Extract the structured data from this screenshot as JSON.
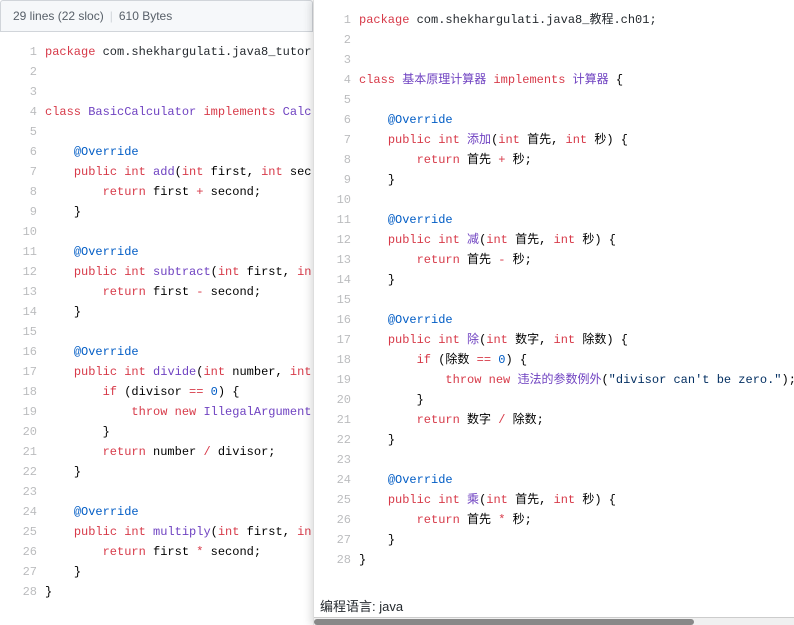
{
  "header": {
    "lines": "29 lines (22 sloc)",
    "size": "610 Bytes"
  },
  "left": {
    "lines": [
      {
        "n": "1",
        "indent": 0,
        "tokens": [
          {
            "t": "package ",
            "c": "kw"
          },
          {
            "t": "com.shekhargulati.java8_tutor",
            "c": "pkg"
          }
        ]
      },
      {
        "n": "2",
        "indent": 0,
        "tokens": []
      },
      {
        "n": "3",
        "indent": 0,
        "tokens": []
      },
      {
        "n": "4",
        "indent": 0,
        "tokens": [
          {
            "t": "class ",
            "c": "kw"
          },
          {
            "t": "BasicCalculator",
            "c": "cls"
          },
          {
            "t": " implements ",
            "c": "kw"
          },
          {
            "t": "Calc",
            "c": "cls"
          }
        ]
      },
      {
        "n": "5",
        "indent": 0,
        "tokens": []
      },
      {
        "n": "6",
        "indent": 1,
        "tokens": [
          {
            "t": "@Override",
            "c": "ann"
          }
        ]
      },
      {
        "n": "7",
        "indent": 1,
        "tokens": [
          {
            "t": "public ",
            "c": "kw"
          },
          {
            "t": "int ",
            "c": "kw"
          },
          {
            "t": "add",
            "c": "fn"
          },
          {
            "t": "(",
            "c": ""
          },
          {
            "t": "int ",
            "c": "kw"
          },
          {
            "t": "first",
            "c": ""
          },
          {
            "t": ", ",
            "c": ""
          },
          {
            "t": "int ",
            "c": "kw"
          },
          {
            "t": "sec",
            "c": ""
          }
        ]
      },
      {
        "n": "8",
        "indent": 2,
        "tokens": [
          {
            "t": "return ",
            "c": "kw"
          },
          {
            "t": "first ",
            "c": ""
          },
          {
            "t": "+",
            "c": "kw"
          },
          {
            "t": " second;",
            "c": ""
          }
        ]
      },
      {
        "n": "9",
        "indent": 1,
        "tokens": [
          {
            "t": "}",
            "c": ""
          }
        ]
      },
      {
        "n": "10",
        "indent": 0,
        "tokens": []
      },
      {
        "n": "11",
        "indent": 1,
        "tokens": [
          {
            "t": "@Override",
            "c": "ann"
          }
        ]
      },
      {
        "n": "12",
        "indent": 1,
        "tokens": [
          {
            "t": "public ",
            "c": "kw"
          },
          {
            "t": "int ",
            "c": "kw"
          },
          {
            "t": "subtract",
            "c": "fn"
          },
          {
            "t": "(",
            "c": ""
          },
          {
            "t": "int ",
            "c": "kw"
          },
          {
            "t": "first",
            "c": ""
          },
          {
            "t": ", ",
            "c": ""
          },
          {
            "t": "in",
            "c": "kw"
          }
        ]
      },
      {
        "n": "13",
        "indent": 2,
        "tokens": [
          {
            "t": "return ",
            "c": "kw"
          },
          {
            "t": "first ",
            "c": ""
          },
          {
            "t": "-",
            "c": "kw"
          },
          {
            "t": " second;",
            "c": ""
          }
        ]
      },
      {
        "n": "14",
        "indent": 1,
        "tokens": [
          {
            "t": "}",
            "c": ""
          }
        ]
      },
      {
        "n": "15",
        "indent": 0,
        "tokens": []
      },
      {
        "n": "16",
        "indent": 1,
        "tokens": [
          {
            "t": "@Override",
            "c": "ann"
          }
        ]
      },
      {
        "n": "17",
        "indent": 1,
        "tokens": [
          {
            "t": "public ",
            "c": "kw"
          },
          {
            "t": "int ",
            "c": "kw"
          },
          {
            "t": "divide",
            "c": "fn"
          },
          {
            "t": "(",
            "c": ""
          },
          {
            "t": "int ",
            "c": "kw"
          },
          {
            "t": "number",
            "c": ""
          },
          {
            "t": ", ",
            "c": ""
          },
          {
            "t": "int",
            "c": "kw"
          }
        ]
      },
      {
        "n": "18",
        "indent": 2,
        "tokens": [
          {
            "t": "if ",
            "c": "kw"
          },
          {
            "t": "(divisor ",
            "c": ""
          },
          {
            "t": "==",
            "c": "kw"
          },
          {
            "t": " ",
            "c": ""
          },
          {
            "t": "0",
            "c": "num"
          },
          {
            "t": ") {",
            "c": ""
          }
        ]
      },
      {
        "n": "19",
        "indent": 3,
        "tokens": [
          {
            "t": "throw ",
            "c": "kw"
          },
          {
            "t": "new ",
            "c": "kw"
          },
          {
            "t": "IllegalArgument",
            "c": "cls"
          }
        ]
      },
      {
        "n": "20",
        "indent": 2,
        "tokens": [
          {
            "t": "}",
            "c": ""
          }
        ]
      },
      {
        "n": "21",
        "indent": 2,
        "tokens": [
          {
            "t": "return ",
            "c": "kw"
          },
          {
            "t": "number ",
            "c": ""
          },
          {
            "t": "/",
            "c": "kw"
          },
          {
            "t": " divisor;",
            "c": ""
          }
        ]
      },
      {
        "n": "22",
        "indent": 1,
        "tokens": [
          {
            "t": "}",
            "c": ""
          }
        ]
      },
      {
        "n": "23",
        "indent": 0,
        "tokens": []
      },
      {
        "n": "24",
        "indent": 1,
        "tokens": [
          {
            "t": "@Override",
            "c": "ann"
          }
        ]
      },
      {
        "n": "25",
        "indent": 1,
        "tokens": [
          {
            "t": "public ",
            "c": "kw"
          },
          {
            "t": "int ",
            "c": "kw"
          },
          {
            "t": "multiply",
            "c": "fn"
          },
          {
            "t": "(",
            "c": ""
          },
          {
            "t": "int ",
            "c": "kw"
          },
          {
            "t": "first",
            "c": ""
          },
          {
            "t": ", ",
            "c": ""
          },
          {
            "t": "in",
            "c": "kw"
          }
        ]
      },
      {
        "n": "26",
        "indent": 2,
        "tokens": [
          {
            "t": "return ",
            "c": "kw"
          },
          {
            "t": "first ",
            "c": ""
          },
          {
            "t": "*",
            "c": "kw"
          },
          {
            "t": " second;",
            "c": ""
          }
        ]
      },
      {
        "n": "27",
        "indent": 1,
        "tokens": [
          {
            "t": "}",
            "c": ""
          }
        ]
      },
      {
        "n": "28",
        "indent": 0,
        "tokens": [
          {
            "t": "}",
            "c": ""
          }
        ]
      }
    ]
  },
  "right": {
    "lines": [
      {
        "n": "1",
        "indent": 0,
        "tokens": [
          {
            "t": "package ",
            "c": "kw"
          },
          {
            "t": "com.shekhargulati.java8_教程.ch01;",
            "c": "pkg"
          }
        ]
      },
      {
        "n": "2",
        "indent": 0,
        "tokens": []
      },
      {
        "n": "3",
        "indent": 0,
        "tokens": []
      },
      {
        "n": "4",
        "indent": 0,
        "tokens": [
          {
            "t": "class ",
            "c": "kw"
          },
          {
            "t": "基本原理计算器",
            "c": "cls"
          },
          {
            "t": " implements ",
            "c": "kw"
          },
          {
            "t": "计算器",
            "c": "cls"
          },
          {
            "t": " {",
            "c": ""
          }
        ]
      },
      {
        "n": "5",
        "indent": 0,
        "tokens": []
      },
      {
        "n": "6",
        "indent": 1,
        "tokens": [
          {
            "t": "@Override",
            "c": "ann"
          }
        ]
      },
      {
        "n": "7",
        "indent": 1,
        "tokens": [
          {
            "t": "public ",
            "c": "kw"
          },
          {
            "t": "int ",
            "c": "kw"
          },
          {
            "t": "添加",
            "c": "fn"
          },
          {
            "t": "(",
            "c": ""
          },
          {
            "t": "int ",
            "c": "kw"
          },
          {
            "t": "首先",
            "c": ""
          },
          {
            "t": ", ",
            "c": ""
          },
          {
            "t": "int ",
            "c": "kw"
          },
          {
            "t": "秒",
            "c": ""
          },
          {
            "t": ") {",
            "c": ""
          }
        ]
      },
      {
        "n": "8",
        "indent": 2,
        "tokens": [
          {
            "t": "return ",
            "c": "kw"
          },
          {
            "t": "首先 ",
            "c": ""
          },
          {
            "t": "+",
            "c": "kw"
          },
          {
            "t": " 秒;",
            "c": ""
          }
        ]
      },
      {
        "n": "9",
        "indent": 1,
        "tokens": [
          {
            "t": "}",
            "c": ""
          }
        ]
      },
      {
        "n": "10",
        "indent": 0,
        "tokens": []
      },
      {
        "n": "11",
        "indent": 1,
        "tokens": [
          {
            "t": "@Override",
            "c": "ann"
          }
        ]
      },
      {
        "n": "12",
        "indent": 1,
        "tokens": [
          {
            "t": "public ",
            "c": "kw"
          },
          {
            "t": "int ",
            "c": "kw"
          },
          {
            "t": "减",
            "c": "fn"
          },
          {
            "t": "(",
            "c": ""
          },
          {
            "t": "int ",
            "c": "kw"
          },
          {
            "t": "首先",
            "c": ""
          },
          {
            "t": ", ",
            "c": ""
          },
          {
            "t": "int ",
            "c": "kw"
          },
          {
            "t": "秒",
            "c": ""
          },
          {
            "t": ") {",
            "c": ""
          }
        ]
      },
      {
        "n": "13",
        "indent": 2,
        "tokens": [
          {
            "t": "return ",
            "c": "kw"
          },
          {
            "t": "首先 ",
            "c": ""
          },
          {
            "t": "-",
            "c": "kw"
          },
          {
            "t": " 秒;",
            "c": ""
          }
        ]
      },
      {
        "n": "14",
        "indent": 1,
        "tokens": [
          {
            "t": "}",
            "c": ""
          }
        ]
      },
      {
        "n": "15",
        "indent": 0,
        "tokens": []
      },
      {
        "n": "16",
        "indent": 1,
        "tokens": [
          {
            "t": "@Override",
            "c": "ann"
          }
        ]
      },
      {
        "n": "17",
        "indent": 1,
        "tokens": [
          {
            "t": "public ",
            "c": "kw"
          },
          {
            "t": "int ",
            "c": "kw"
          },
          {
            "t": "除",
            "c": "fn"
          },
          {
            "t": "(",
            "c": ""
          },
          {
            "t": "int ",
            "c": "kw"
          },
          {
            "t": "数字",
            "c": ""
          },
          {
            "t": ", ",
            "c": ""
          },
          {
            "t": "int ",
            "c": "kw"
          },
          {
            "t": "除数",
            "c": ""
          },
          {
            "t": ") {",
            "c": ""
          }
        ]
      },
      {
        "n": "18",
        "indent": 2,
        "tokens": [
          {
            "t": "if ",
            "c": "kw"
          },
          {
            "t": "(除数 ",
            "c": ""
          },
          {
            "t": "==",
            "c": "kw"
          },
          {
            "t": " ",
            "c": ""
          },
          {
            "t": "0",
            "c": "num"
          },
          {
            "t": ") {",
            "c": ""
          }
        ]
      },
      {
        "n": "19",
        "indent": 3,
        "tokens": [
          {
            "t": "throw ",
            "c": "kw"
          },
          {
            "t": "new ",
            "c": "kw"
          },
          {
            "t": "违法的参数例外",
            "c": "cls"
          },
          {
            "t": "(",
            "c": ""
          },
          {
            "t": "\"divisor can't be zero.\"",
            "c": "str"
          },
          {
            "t": ");",
            "c": ""
          }
        ]
      },
      {
        "n": "20",
        "indent": 2,
        "tokens": [
          {
            "t": "}",
            "c": ""
          }
        ]
      },
      {
        "n": "21",
        "indent": 2,
        "tokens": [
          {
            "t": "return ",
            "c": "kw"
          },
          {
            "t": "数字 ",
            "c": ""
          },
          {
            "t": "/",
            "c": "kw"
          },
          {
            "t": " 除数;",
            "c": ""
          }
        ]
      },
      {
        "n": "22",
        "indent": 1,
        "tokens": [
          {
            "t": "}",
            "c": ""
          }
        ]
      },
      {
        "n": "23",
        "indent": 0,
        "tokens": []
      },
      {
        "n": "24",
        "indent": 1,
        "tokens": [
          {
            "t": "@Override",
            "c": "ann"
          }
        ]
      },
      {
        "n": "25",
        "indent": 1,
        "tokens": [
          {
            "t": "public ",
            "c": "kw"
          },
          {
            "t": "int ",
            "c": "kw"
          },
          {
            "t": "乘",
            "c": "fn"
          },
          {
            "t": "(",
            "c": ""
          },
          {
            "t": "int ",
            "c": "kw"
          },
          {
            "t": "首先",
            "c": ""
          },
          {
            "t": ", ",
            "c": ""
          },
          {
            "t": "int ",
            "c": "kw"
          },
          {
            "t": "秒",
            "c": ""
          },
          {
            "t": ") {",
            "c": ""
          }
        ]
      },
      {
        "n": "26",
        "indent": 2,
        "tokens": [
          {
            "t": "return ",
            "c": "kw"
          },
          {
            "t": "首先 ",
            "c": ""
          },
          {
            "t": "*",
            "c": "kw"
          },
          {
            "t": " 秒;",
            "c": ""
          }
        ]
      },
      {
        "n": "27",
        "indent": 1,
        "tokens": [
          {
            "t": "}",
            "c": ""
          }
        ]
      },
      {
        "n": "28",
        "indent": 0,
        "tokens": [
          {
            "t": "}",
            "c": ""
          }
        ]
      }
    ]
  },
  "footer": {
    "lang_label": "编程语言: java"
  }
}
